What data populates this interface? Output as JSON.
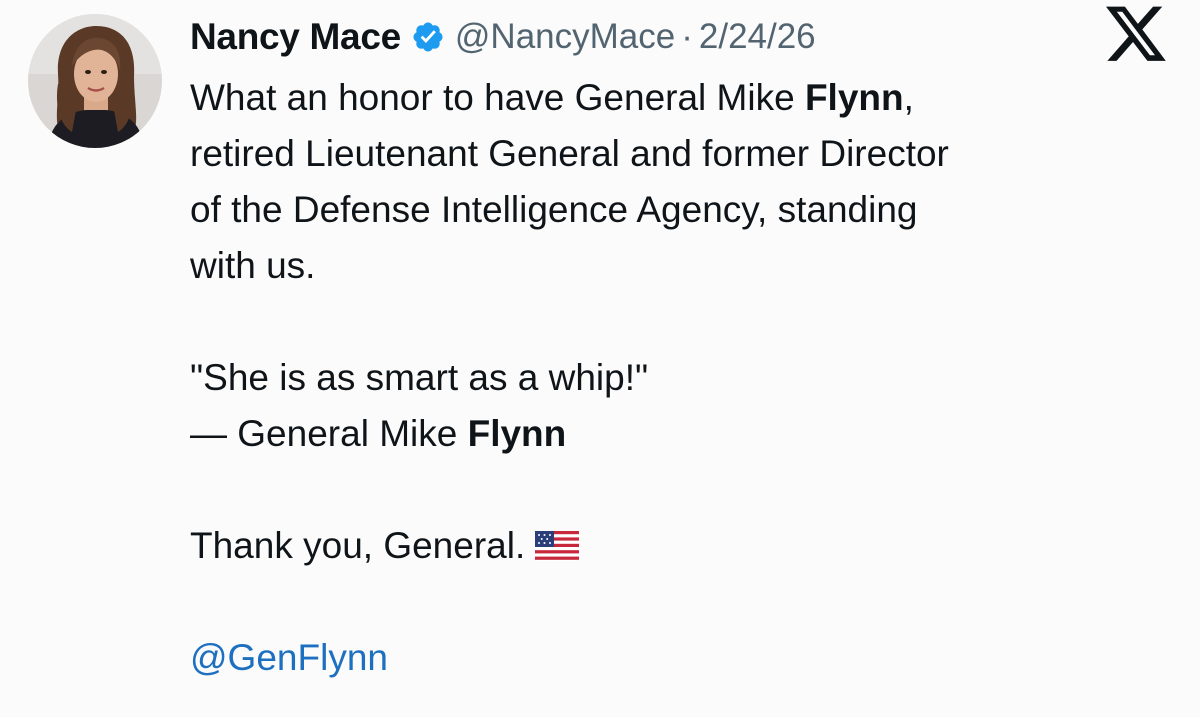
{
  "tweet": {
    "author": {
      "display_name": "Nancy Mace",
      "handle": "@NancyMace",
      "verified_icon": "verified-badge-icon"
    },
    "separator": "·",
    "date": "2/24/26",
    "platform_icon": "x-logo-icon",
    "text": {
      "line1_prefix": "What an honor to have General Mike ",
      "line1_bold": "Flynn",
      "line1_suffix": ",",
      "line2": "retired Lieutenant General and former Director",
      "line3": "of the Defense Intelligence Agency, standing",
      "line4": "with us.",
      "quote": "\"She is as smart as a whip!\"",
      "attribution_prefix": "— General Mike ",
      "attribution_bold": "Flynn",
      "thanks": "Thank you, General.",
      "flag_icon": "us-flag-icon",
      "mention": "@GenFlynn"
    }
  },
  "colors": {
    "text": "#0f1419",
    "secondary_text": "#536471",
    "link": "#1d6fbf",
    "verified": "#1d9bf0",
    "background": "#fbfbfb"
  }
}
